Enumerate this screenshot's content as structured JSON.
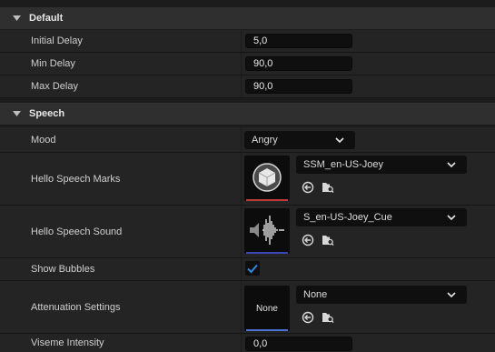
{
  "sections": {
    "default": "Default",
    "speech": "Speech"
  },
  "fields": {
    "initial_delay": {
      "label": "Initial Delay",
      "value": "5,0"
    },
    "min_delay": {
      "label": "Min Delay",
      "value": "90,0"
    },
    "max_delay": {
      "label": "Max Delay",
      "value": "90,0"
    },
    "mood": {
      "label": "Mood",
      "value": "Angry"
    },
    "hello_speech_marks": {
      "label": "Hello Speech Marks",
      "asset": "SSM_en-US-Joey"
    },
    "hello_speech_sound": {
      "label": "Hello Speech Sound",
      "asset": "S_en-US-Joey_Cue"
    },
    "show_bubbles": {
      "label": "Show Bubbles",
      "checked": true
    },
    "attenuation_settings": {
      "label": "Attenuation Settings",
      "asset": "None",
      "thumb_text": "None"
    },
    "viseme_intensity": {
      "label": "Viseme Intensity",
      "value": "0,0"
    }
  },
  "colors": {
    "marks_bar": "#c23b3b",
    "sound_bar": "#3c46b8",
    "atten_bar": "#4a73d1",
    "check": "#2f8be0"
  },
  "icons": {
    "use_selected": "arrow-left-circle-icon",
    "browse": "folder-search-icon",
    "expand": "triangle-down-icon",
    "dropdown": "chevron-down-icon"
  }
}
